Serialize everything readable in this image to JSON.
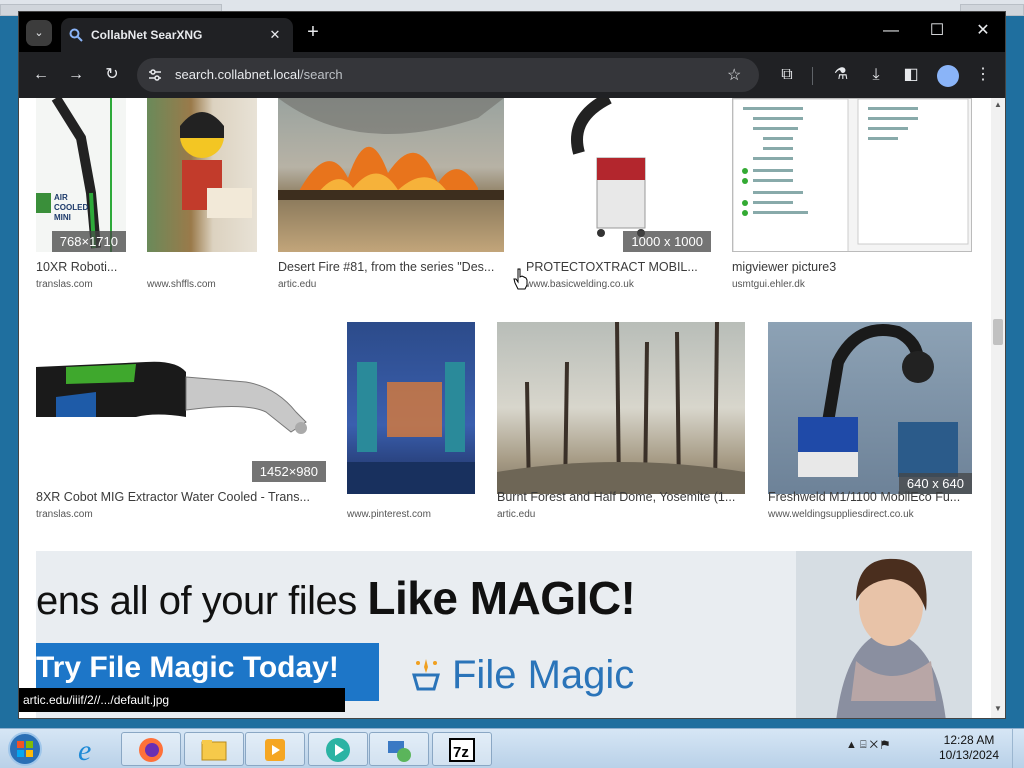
{
  "browser": {
    "tab_title": "CollabNet SearXNG",
    "url_host": "search.collabnet.local",
    "url_path": "/search",
    "status_url": "artic.edu/iiif/2//.../default.jpg"
  },
  "results_row1": [
    {
      "title": "10XR Roboti...",
      "source": "translas.com",
      "dims": "768×1710",
      "art_text": "AIR COOLED MINI"
    },
    {
      "title": "",
      "source": "www.shffls.com",
      "dims": ""
    },
    {
      "title": "Desert Fire #81, from the series \"Des...",
      "source": "artic.edu",
      "dims": ""
    },
    {
      "title": "PROTECTOXTRACT MOBIL...",
      "source": "www.basicwelding.co.uk",
      "dims": "1000 x 1000"
    },
    {
      "title": "migviewer picture3",
      "source": "usmtgui.ehler.dk",
      "dims": ""
    }
  ],
  "results_row2": [
    {
      "title": "8XR Cobot MIG Extractor Water Cooled - Trans...",
      "source": "translas.com",
      "dims": "1452×980"
    },
    {
      "title": "",
      "source": "www.pinterest.com",
      "dims": ""
    },
    {
      "title": "Burnt Forest and Half Dome, Yosemite (1...",
      "source": "artic.edu",
      "dims": ""
    },
    {
      "title": "Freshweld M1/1100 MobilEco Fu...",
      "source": "www.weldingsuppliesdirect.co.uk",
      "dims": "640 x 640"
    }
  ],
  "ad": {
    "headline_start": "ens all of your files ",
    "headline_bold": "Like MAGIC!",
    "cta": "Try File Magic Today!",
    "brand": "File Magic"
  },
  "taskbar": {
    "time": "12:28 AM",
    "date": "10/13/2024",
    "apps": [
      "internet-explorer",
      "firefox",
      "file-explorer",
      "media-player",
      "app-circle",
      "network-app",
      "7zip"
    ]
  },
  "colors": {
    "accent": "#8ab4f8",
    "ad_button": "#1d76c8",
    "brand_text": "#2a74b9"
  }
}
